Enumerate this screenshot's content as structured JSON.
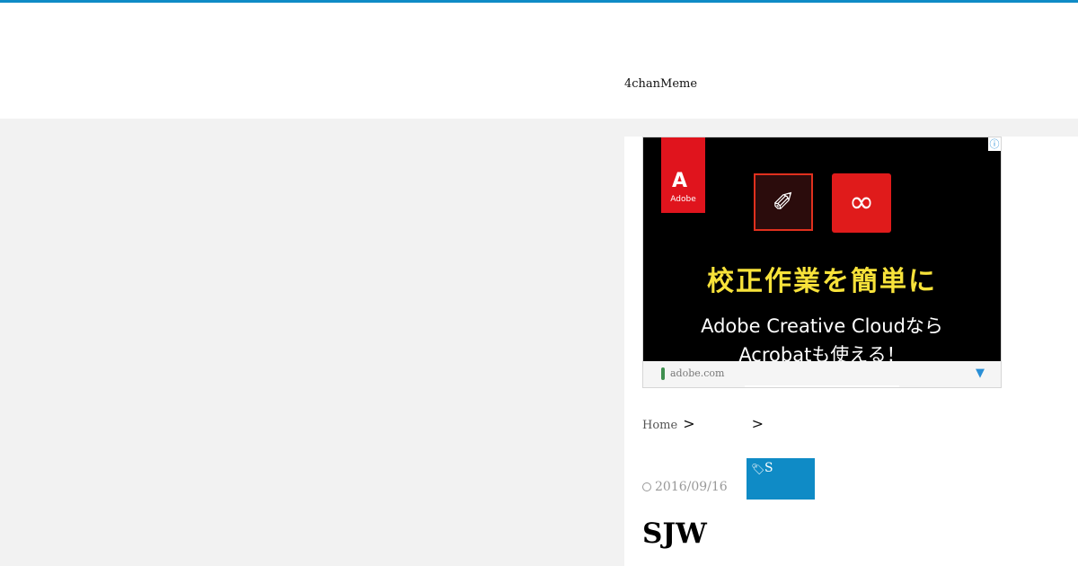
{
  "header": {
    "site_title": "4chanMeme"
  },
  "ad": {
    "adobe_logo_text": "Adobe",
    "headline": "校正作業を簡単に",
    "subline_1": "Adobe Creative Cloudなら",
    "subline_2": "Acrobatも使える！",
    "domain": "adobe.com",
    "info_icon": "info-icon",
    "dropdown_icon": "chevron-down-icon"
  },
  "breadcrumb": {
    "home": "Home",
    "separator": ">"
  },
  "post": {
    "date": "2016/09/16",
    "tag_label": "S",
    "title": "SJW"
  },
  "colors": {
    "accent": "#0f8bc6",
    "background": "#f2f2f2"
  }
}
